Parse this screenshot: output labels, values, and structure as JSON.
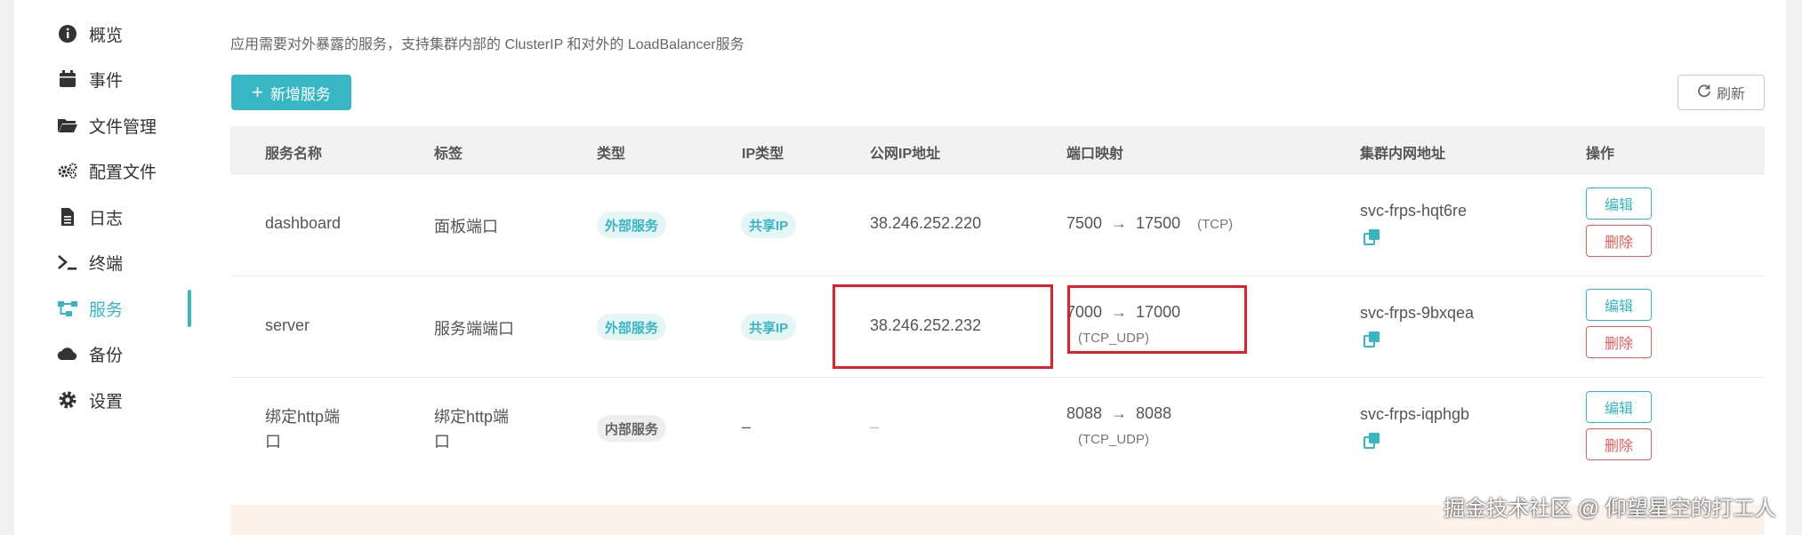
{
  "sidebar": {
    "items": [
      {
        "label": "概览",
        "icon": "info-icon"
      },
      {
        "label": "事件",
        "icon": "calendar-icon"
      },
      {
        "label": "文件管理",
        "icon": "folder-icon"
      },
      {
        "label": "配置文件",
        "icon": "gears-icon"
      },
      {
        "label": "日志",
        "icon": "document-icon"
      },
      {
        "label": "终端",
        "icon": "terminal-icon"
      },
      {
        "label": "服务",
        "icon": "network-icon",
        "active": true
      },
      {
        "label": "备份",
        "icon": "cloud-icon"
      },
      {
        "label": "设置",
        "icon": "gear-icon"
      }
    ]
  },
  "main": {
    "description": "应用需要对外暴露的服务，支持集群内部的 ClusterIP 和对外的 LoadBalancer服务",
    "add_button": "新增服务",
    "refresh_button": "刷新",
    "columns": [
      "服务名称",
      "标签",
      "类型",
      "IP类型",
      "公网IP地址",
      "端口映射",
      "集群内网地址",
      "操作"
    ],
    "rows": [
      {
        "name": "dashboard",
        "label": "面板端口",
        "type": "外部服务",
        "ip_type": "共享IP",
        "public_ip": "38.246.252.220",
        "port_from": "7500",
        "port_to": "17500",
        "protocol": "(TCP)",
        "cluster_addr": "svc-frps-hqt6re",
        "edit": "编辑",
        "delete": "删除"
      },
      {
        "name": "server",
        "label": "服务端端口",
        "type": "外部服务",
        "ip_type": "共享IP",
        "public_ip": "38.246.252.232",
        "port_from": "7000",
        "port_to": "17000",
        "protocol": "(TCP_UDP)",
        "cluster_addr": "svc-frps-9bxqea",
        "edit": "编辑",
        "delete": "删除"
      },
      {
        "name_line1": "绑定http端",
        "name_line2": "口",
        "label_line1": "绑定http端",
        "label_line2": "口",
        "type": "内部服务",
        "ip_type": "–",
        "public_ip": "–",
        "port_from": "8088",
        "port_to": "8088",
        "protocol": "(TCP_UDP)",
        "cluster_addr": "svc-frps-iqphgb",
        "edit": "编辑",
        "delete": "删除"
      }
    ]
  },
  "arrow_glyph": "→",
  "watermark": "掘金技术社区 @ 仰望星空的打工人",
  "colors": {
    "accent": "#38b6c3",
    "danger": "#e25c5c",
    "highlight": "#e0202a"
  }
}
